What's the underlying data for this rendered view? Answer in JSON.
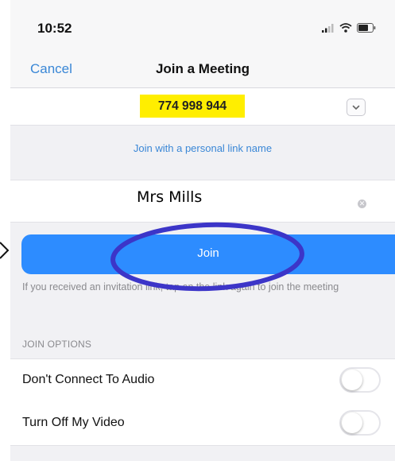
{
  "status_bar": {
    "time": "10:52",
    "icons": [
      "signal-icon",
      "wifi-icon",
      "battery-icon"
    ]
  },
  "nav": {
    "cancel_label": "Cancel",
    "title": "Join a Meeting"
  },
  "meeting": {
    "id": "774 998 944",
    "highlight_color": "#ffee00",
    "personal_link_label": "Join with a personal link name"
  },
  "name_field": {
    "value": "Mrs Mills"
  },
  "join": {
    "label": "Join",
    "color": "#2d8cff",
    "hint": "If you received an invitation link, tap on the link again to join the meeting"
  },
  "join_options": {
    "header": "JOIN OPTIONS",
    "options": [
      {
        "label": "Don't Connect To Audio",
        "enabled": false
      },
      {
        "label": "Turn Off My Video",
        "enabled": false
      }
    ]
  },
  "colors": {
    "accent": "#3a87d6",
    "annotation": "#3c35c8"
  }
}
